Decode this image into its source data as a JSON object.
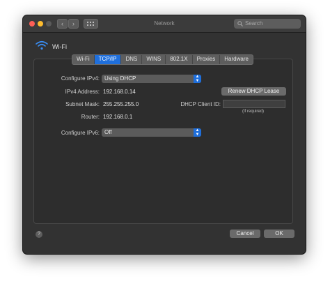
{
  "window": {
    "title": "Network"
  },
  "toolbar": {
    "back_icon": "‹",
    "forward_icon": "›",
    "grid_icon": "grid-icon",
    "search_placeholder": "Search"
  },
  "header": {
    "interface_name": "Wi-Fi"
  },
  "tabs": [
    {
      "label": "Wi-Fi",
      "active": false
    },
    {
      "label": "TCP/IP",
      "active": true
    },
    {
      "label": "DNS",
      "active": false
    },
    {
      "label": "WINS",
      "active": false
    },
    {
      "label": "802.1X",
      "active": false
    },
    {
      "label": "Proxies",
      "active": false
    },
    {
      "label": "Hardware",
      "active": false
    }
  ],
  "tcpip": {
    "configure_ipv4_label": "Configure IPv4:",
    "configure_ipv4_value": "Using DHCP",
    "ipv4_address_label": "IPv4 Address:",
    "ipv4_address_value": "192.168.0.14",
    "subnet_mask_label": "Subnet Mask:",
    "subnet_mask_value": "255.255.255.0",
    "router_label": "Router:",
    "router_value": "192.168.0.1",
    "renew_button": "Renew DHCP Lease",
    "dhcp_client_id_label": "DHCP Client ID:",
    "dhcp_client_id_value": "",
    "dhcp_client_id_hint": "(If required)",
    "configure_ipv6_label": "Configure IPv6:",
    "configure_ipv6_value": "Off"
  },
  "footer": {
    "help_label": "?",
    "cancel_label": "Cancel",
    "ok_label": "OK"
  },
  "colors": {
    "accent": "#1f6fdc",
    "close": "#fe5f57",
    "minimize": "#febc2e",
    "zoom": "#5a5a5a"
  }
}
